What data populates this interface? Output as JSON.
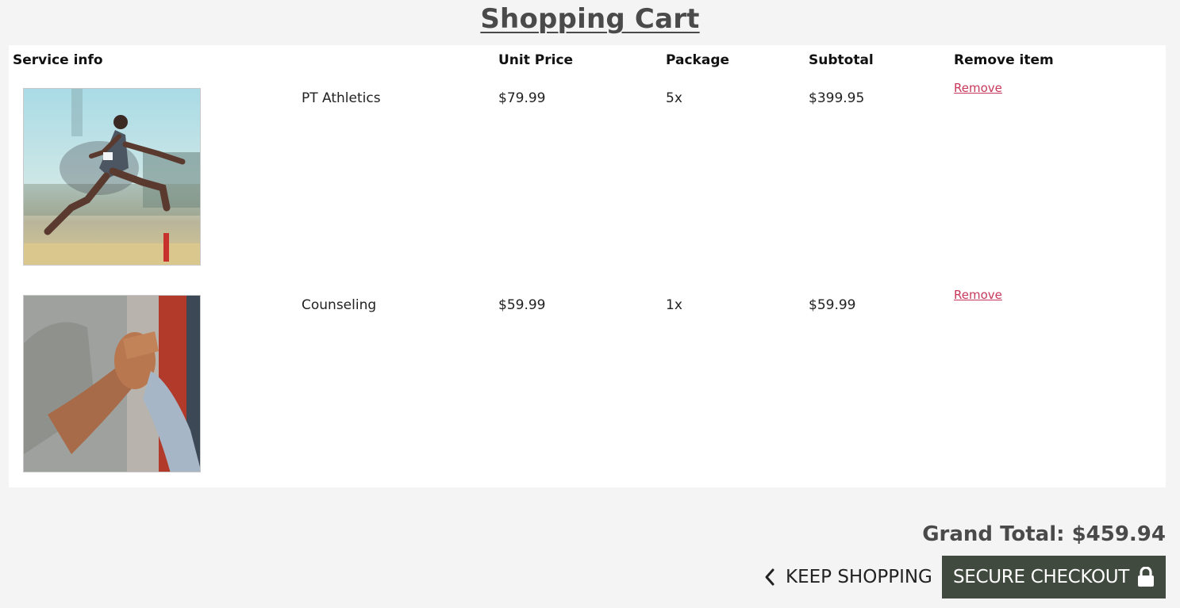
{
  "page": {
    "title": "Shopping Cart"
  },
  "table": {
    "headers": {
      "service_info": "Service info",
      "unit_price": "Unit Price",
      "package": "Package",
      "subtotal": "Subtotal",
      "remove_item": "Remove item"
    },
    "rows": [
      {
        "image_icon": "athlete-hurdle-photo",
        "name": "PT Athletics",
        "unit_price": "$79.99",
        "package": "5x",
        "subtotal": "$399.95",
        "remove_label": "Remove"
      },
      {
        "image_icon": "handshake-photo",
        "name": "Counseling",
        "unit_price": "$59.99",
        "package": "1x",
        "subtotal": "$59.99",
        "remove_label": "Remove"
      }
    ]
  },
  "summary": {
    "grand_total": "Grand Total: $459.94"
  },
  "actions": {
    "keep_shopping_label": "KEEP SHOPPING",
    "keep_shopping_icon": "chevron-left-icon",
    "checkout_label": "SECURE CHECKOUT",
    "checkout_icon": "lock-icon"
  },
  "colors": {
    "background": "#f4f4f4",
    "panel": "#ffffff",
    "remove_link": "#c8385a",
    "checkout_button": "#414a3f"
  }
}
